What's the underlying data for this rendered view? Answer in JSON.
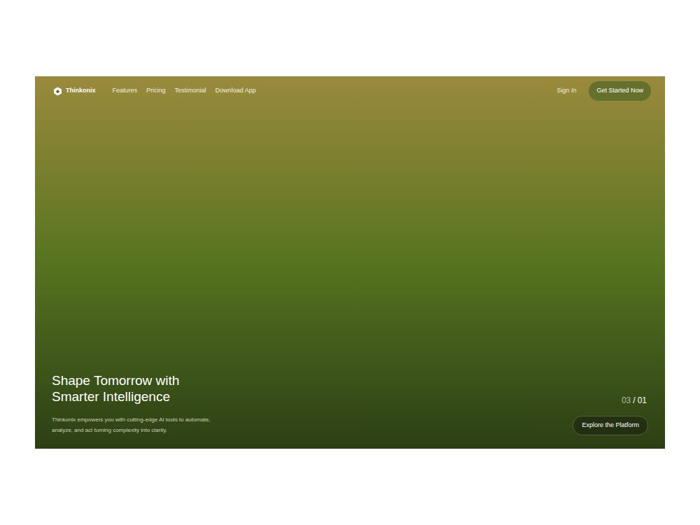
{
  "nav": {
    "logo": "Thinkonix",
    "links": [
      {
        "label": "Features"
      },
      {
        "label": "Pricing"
      },
      {
        "label": "Testimonial"
      },
      {
        "label": "Download App"
      }
    ],
    "sign_in": "Sign In",
    "cta": "Get Started Now"
  },
  "hero": {
    "title_lines": [
      "Shape Tomorrow with",
      "Smarter Intelligence"
    ],
    "description_lines": [
      "Thinkonix empowers you with cutting-edge AI tools to automate,",
      "analyze, and act turning complexity into clarity."
    ]
  },
  "counter": {
    "current": "03",
    "separator": "/",
    "total": "01"
  },
  "button": "Explore the Platform"
}
